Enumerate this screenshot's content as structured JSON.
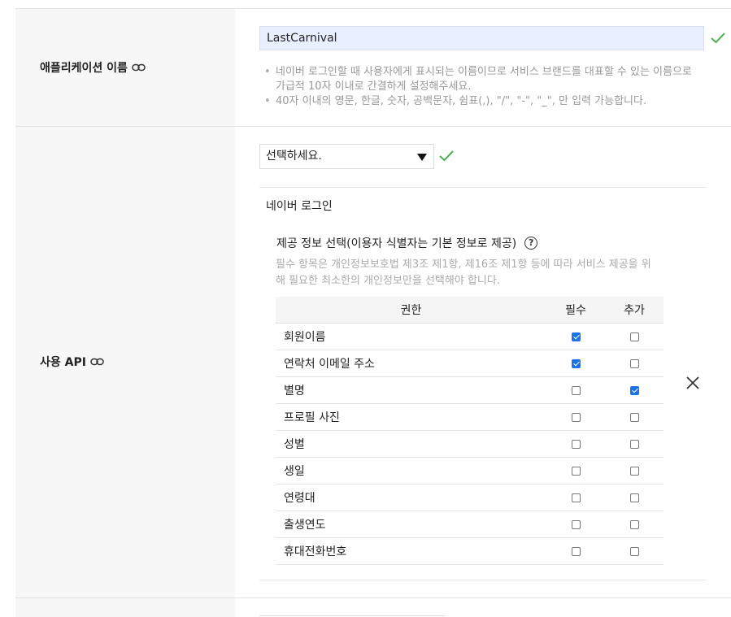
{
  "app_name_row": {
    "label": "애플리케이션 이름",
    "value": "LastCarnival",
    "notes": [
      "네이버 로그인할 때 사용자에게 표시되는 이름이므로 서비스 브랜드를 대표할 수 있는 이름으로 가급적 10자 이내로 간결하게 설정해주세요.",
      "40자 이내의 영문, 한글, 숫자, 공백문자, 쉼표(,), \"/\", \"-\", \"_\", 만 입력 가능합니다."
    ]
  },
  "api_row": {
    "label": "사용 API",
    "select_value": "선택하세요.",
    "api_name": "네이버 로그인",
    "info_title": "제공 정보 선택(이용자 식별자는 기본 정보로 제공)",
    "help_symbol": "?",
    "info_desc": "필수 항목은 개인정보보호법 제3조 제1항, 제16조 제1항 등에 따라 서비스 제공을 위해 필요한 최소한의 개인정보만을 선택해야 합니다.",
    "table": {
      "headers": [
        "권한",
        "필수",
        "추가"
      ],
      "rows": [
        {
          "name": "회원이름",
          "required": true,
          "additional": false
        },
        {
          "name": "연락처 이메일 주소",
          "required": true,
          "additional": false
        },
        {
          "name": "별명",
          "required": false,
          "additional": true
        },
        {
          "name": "프로필 사진",
          "required": false,
          "additional": false
        },
        {
          "name": "성별",
          "required": false,
          "additional": false
        },
        {
          "name": "생일",
          "required": false,
          "additional": false
        },
        {
          "name": "연령대",
          "required": false,
          "additional": false
        },
        {
          "name": "출생연도",
          "required": false,
          "additional": false
        },
        {
          "name": "휴대전화번호",
          "required": false,
          "additional": false
        }
      ]
    }
  },
  "icons": {
    "link": "link-icon",
    "valid": "check-icon",
    "remove": "close-icon",
    "help": "help-icon",
    "dropdown": "chevron-down-icon"
  },
  "colors": {
    "check_green": "#4caf50",
    "checkbox_blue": "#1a73e8",
    "input_bg": "#e8efff"
  }
}
